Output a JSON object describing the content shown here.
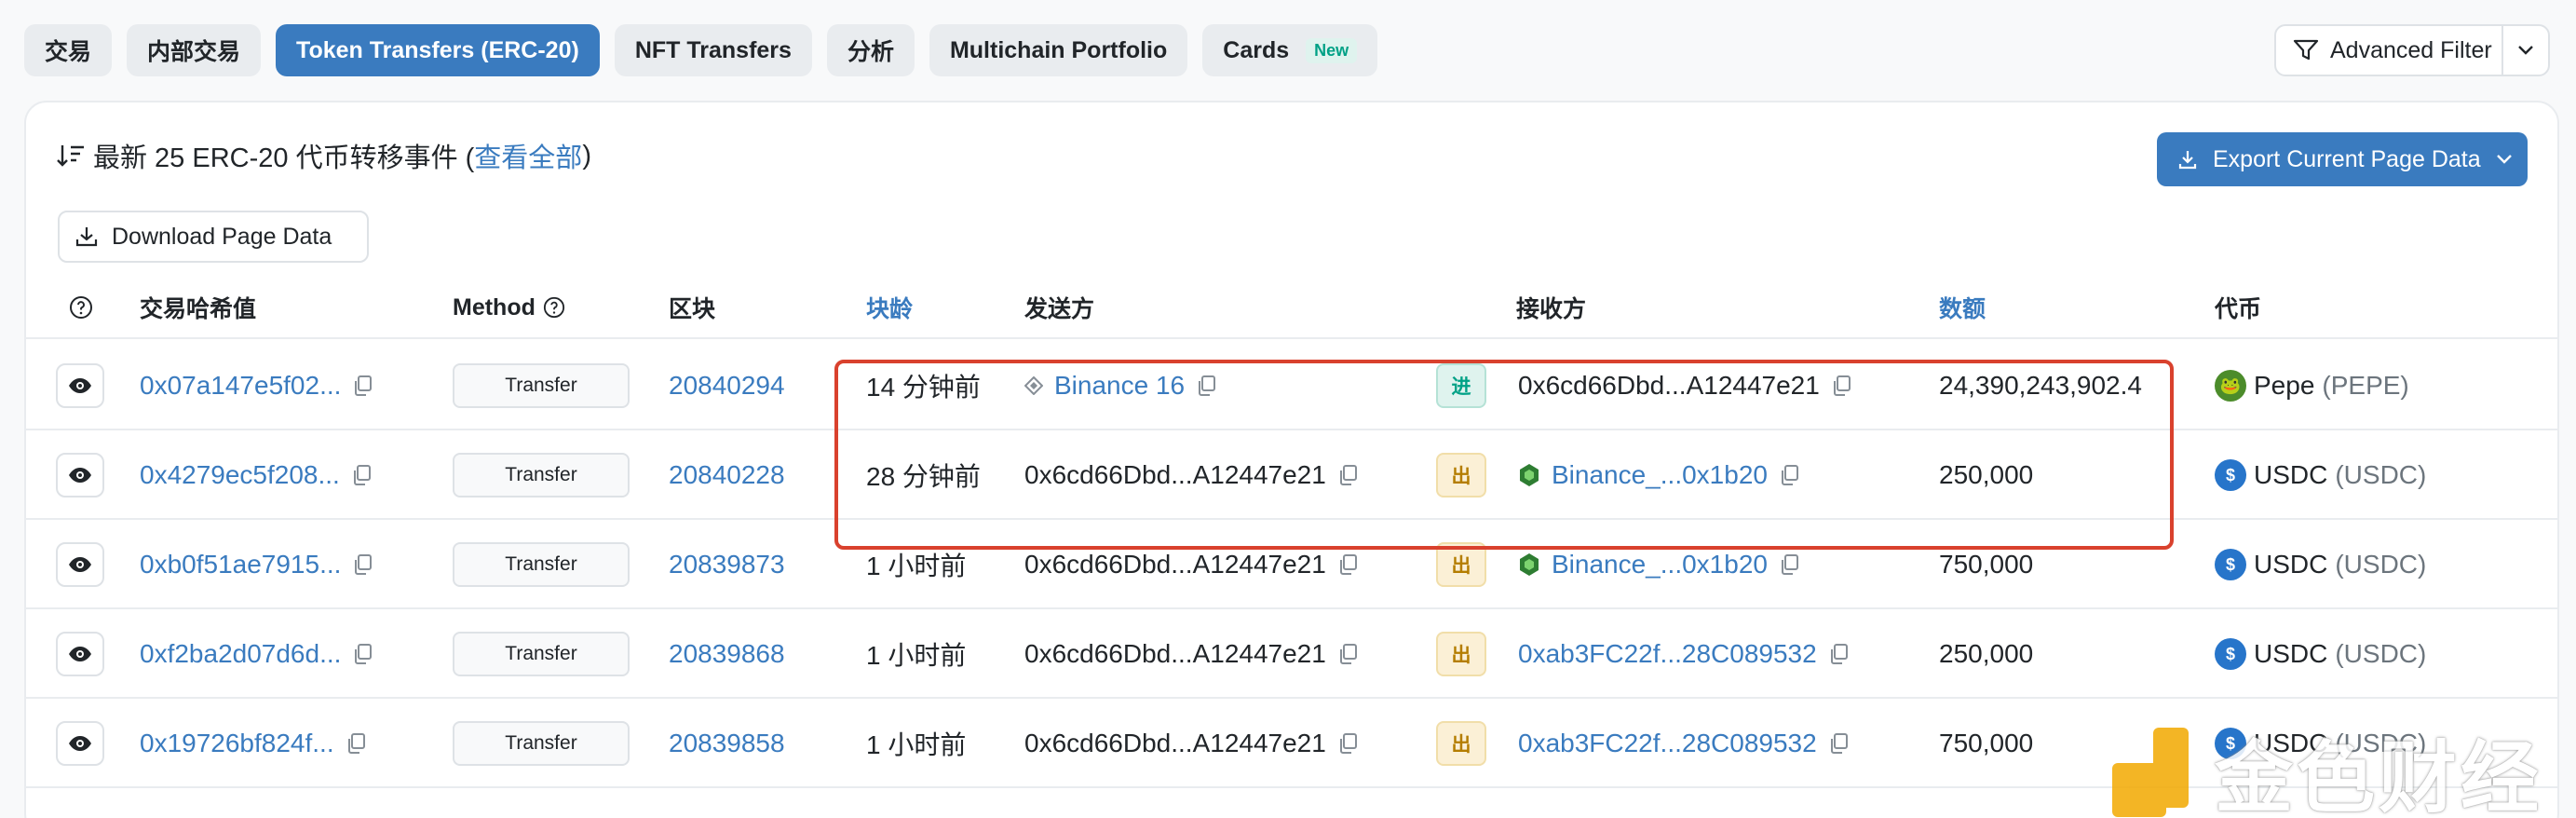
{
  "tabs": [
    {
      "label": "交易",
      "active": false
    },
    {
      "label": "内部交易",
      "active": false
    },
    {
      "label": "Token Transfers (ERC-20)",
      "active": true
    },
    {
      "label": "NFT Transfers",
      "active": false
    },
    {
      "label": "分析",
      "active": false
    },
    {
      "label": "Multichain Portfolio",
      "active": false
    },
    {
      "label": "Cards",
      "active": false,
      "badge": "New"
    }
  ],
  "advanced_filter": {
    "label": "Advanced Filter",
    "icon": "filter-icon"
  },
  "header": {
    "title_prefix": "最新 25 ERC-20 代币转移事件 (",
    "title_link": "查看全部",
    "title_suffix": ")",
    "export_label": "Export Current Page Data",
    "download_label": "Download Page Data"
  },
  "table": {
    "columns": {
      "hash": "交易哈希值",
      "method": "Method",
      "block": "区块",
      "age": "块龄",
      "from": "发送方",
      "to": "接收方",
      "amount": "数额",
      "token": "代币"
    },
    "rows": [
      {
        "hash": "0x07a147e5f02...",
        "method": "Transfer",
        "block": "20840294",
        "age": "14 分钟前",
        "from": "Binance 16",
        "from_is_link": true,
        "direction": "进",
        "to": "0x6cd66Dbd...A12447e21",
        "to_is_link": false,
        "amount": "24,390,243,902.4",
        "token_name": "Pepe",
        "token_symbol": "(PEPE)",
        "token_icon": "pepe-icon"
      },
      {
        "hash": "0x4279ec5f208...",
        "method": "Transfer",
        "block": "20840228",
        "age": "28 分钟前",
        "from": "0x6cd66Dbd...A12447e21",
        "from_is_link": false,
        "direction": "出",
        "to": "Binance_...0x1b20",
        "to_is_link": true,
        "amount": "250,000",
        "token_name": "USDC",
        "token_symbol": "(USDC)",
        "token_icon": "usdc-icon"
      },
      {
        "hash": "0xb0f51ae7915...",
        "method": "Transfer",
        "block": "20839873",
        "age": "1 小时前",
        "from": "0x6cd66Dbd...A12447e21",
        "from_is_link": false,
        "direction": "出",
        "to": "Binance_...0x1b20",
        "to_is_link": true,
        "amount": "750,000",
        "token_name": "USDC",
        "token_symbol": "(USDC)",
        "token_icon": "usdc-icon"
      },
      {
        "hash": "0xf2ba2d07d6d...",
        "method": "Transfer",
        "block": "20839868",
        "age": "1 小时前",
        "from": "0x6cd66Dbd...A12447e21",
        "from_is_link": false,
        "direction": "出",
        "to": "0xab3FC22f...28C089532",
        "to_is_link": true,
        "amount": "250,000",
        "token_name": "USDC",
        "token_symbol": "(USDC)",
        "token_icon": "usdc-icon"
      },
      {
        "hash": "0x19726bf824f...",
        "method": "Transfer",
        "block": "20839858",
        "age": "1 小时前",
        "from": "0x6cd66Dbd...A12447e21",
        "from_is_link": false,
        "direction": "出",
        "to": "0xab3FC22f...28C089532",
        "to_is_link": true,
        "amount": "750,000",
        "token_name": "USDC",
        "token_symbol": "(USDC)",
        "token_icon": "usdc-icon"
      }
    ]
  },
  "watermark": {
    "text": "金色财经"
  },
  "colors": {
    "accent": "#3a7bbf",
    "highlight": "#d9412d",
    "in": "#00a186",
    "out": "#b47d00"
  }
}
